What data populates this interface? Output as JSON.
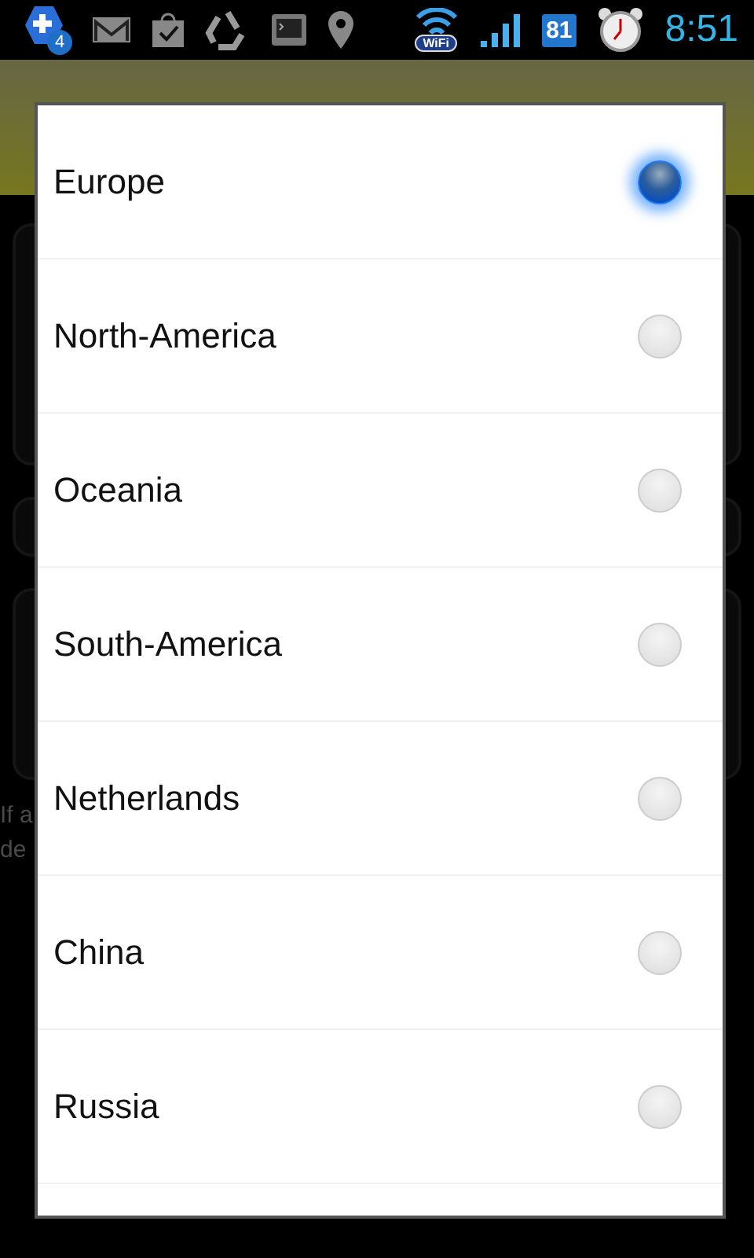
{
  "status_bar": {
    "notification_count": "4",
    "wifi_label": "WiFi",
    "battery": "81",
    "time": "8:51"
  },
  "background": {
    "texts": [
      "If a",
      "de"
    ]
  },
  "dialog": {
    "options": [
      {
        "label": "Europe",
        "selected": true
      },
      {
        "label": "North-America",
        "selected": false
      },
      {
        "label": "Oceania",
        "selected": false
      },
      {
        "label": "South-America",
        "selected": false
      },
      {
        "label": "Netherlands",
        "selected": false
      },
      {
        "label": "China",
        "selected": false
      },
      {
        "label": "Russia",
        "selected": false
      }
    ]
  }
}
